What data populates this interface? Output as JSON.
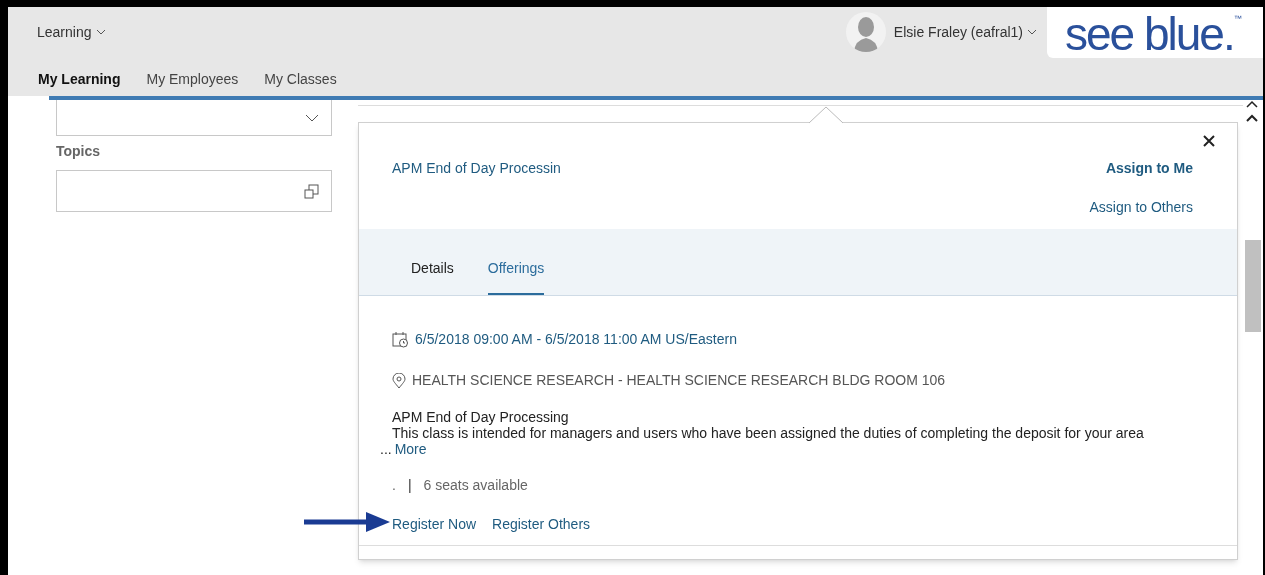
{
  "header": {
    "app_menu": "Learning",
    "user": "Elsie Fraley (eafral1)",
    "logo": "see blue.",
    "logo_mark": "™"
  },
  "nav_tabs": [
    {
      "label": "My Learning",
      "selected": true
    },
    {
      "label": "My Employees",
      "selected": false
    },
    {
      "label": "My Classes",
      "selected": false
    }
  ],
  "filters": {
    "topics_label": "Topics"
  },
  "popup": {
    "title": "APM End of Day Processin",
    "assign_to_me": "Assign to Me",
    "assign_to_others": "Assign to Others",
    "tabs": [
      {
        "label": "Details",
        "selected": false
      },
      {
        "label": "Offerings",
        "selected": true
      }
    ],
    "offering": {
      "date": "6/5/2018 09:00 AM - 6/5/2018 11:00 AM US/Eastern",
      "location": "HEALTH SCIENCE RESEARCH - HEALTH SCIENCE RESEARCH BLDG ROOM 106",
      "name": "APM End of Day Processing",
      "description": "This class is intended for managers and users who have been assigned the duties of completing the deposit for your area",
      "ellipsis": "...",
      "more": "More",
      "dot": ".",
      "separator": "|",
      "seats": "6 seats available",
      "register_now": "Register Now",
      "register_others": "Register Others"
    }
  }
}
